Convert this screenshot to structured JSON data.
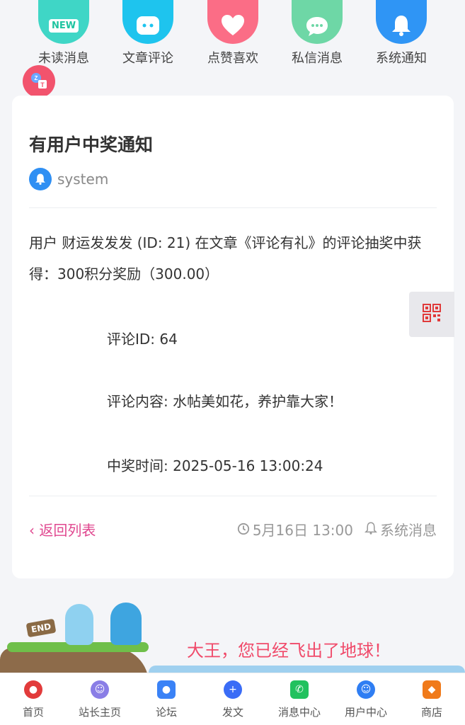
{
  "top_nav": [
    {
      "label": "未读消息",
      "icon": "new-message-icon",
      "badge": "NEW"
    },
    {
      "label": "文章评论",
      "icon": "comment-bubble-icon"
    },
    {
      "label": "点赞喜欢",
      "icon": "heart-icon"
    },
    {
      "label": "私信消息",
      "icon": "chat-bubble-icon"
    },
    {
      "label": "系统通知",
      "icon": "bell-icon"
    }
  ],
  "card": {
    "title": "有用户中奖通知",
    "author": "system",
    "body": "用户 财运发发发 (ID: 21) 在文章《评论有礼》的评论抽奖中获得：300积分奖励（300.00）",
    "details": {
      "comment_id": "评论ID: 64",
      "comment_content": "评论内容: 水帖美如花，养护靠大家！",
      "win_time": "中奖时间: 2025-05-16 13:00:24"
    },
    "back_label": "‹ 返回列表",
    "date": "5月16日 13:00",
    "category": "系统消息"
  },
  "banner": {
    "sign": "END",
    "slogan": "大王，您已经飞出了地球！"
  },
  "tabbar": [
    {
      "label": "首页",
      "icon": "home-drum-icon",
      "color": "#e23b3b"
    },
    {
      "label": "站长主页",
      "icon": "user-circle-icon",
      "color": "#8a7ee6"
    },
    {
      "label": "论坛",
      "icon": "group-icon",
      "color": "#3a82f6"
    },
    {
      "label": "发文",
      "icon": "plus-circle-icon",
      "color": "#3a6cf6"
    },
    {
      "label": "消息中心",
      "icon": "whatsapp-icon",
      "color": "#22c15e"
    },
    {
      "label": "用户中心",
      "icon": "support-agent-icon",
      "color": "#2f7ef3"
    },
    {
      "label": "商店",
      "icon": "shop-shield-icon",
      "color": "#f07a1a"
    }
  ],
  "colors": {
    "accent_pink": "#e0478f",
    "author_blue": "#2f8ff3",
    "slogan_red": "#f04a6a"
  }
}
